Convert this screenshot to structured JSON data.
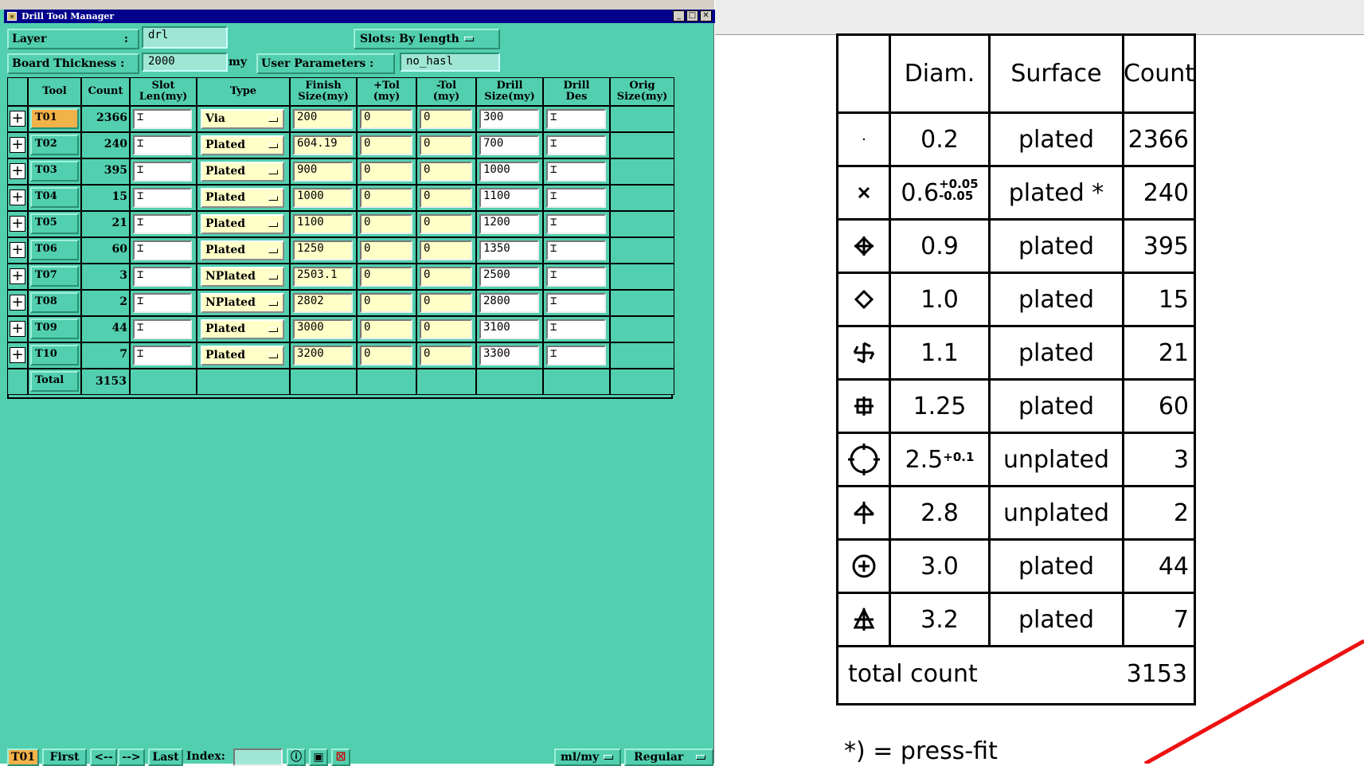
{
  "window": {
    "title": "Drill Tool Manager"
  },
  "form": {
    "layer_label": "Layer",
    "layer_colon": ":",
    "layer_value": "drl",
    "slots_label": "Slots:",
    "slots_value": "By length",
    "thickness_label": "Board Thickness :",
    "thickness_value": "2000",
    "thickness_unit": "my",
    "user_params_label": "User Parameters :",
    "user_params_value": "no_hasl"
  },
  "table": {
    "headers": [
      "Tool",
      "Count",
      "Slot\nLen(my)",
      "Type",
      "Finish\nSize(my)",
      "+Tol\n(my)",
      "-Tol\n(my)",
      "Drill\nSize(my)",
      "Drill\nDes",
      "Orig\nSize(my)"
    ],
    "rows": [
      {
        "tool": "T01",
        "count": "2366",
        "type": "Via",
        "finish": "200",
        "ptol": "0",
        "ntol": "0",
        "drill": "300"
      },
      {
        "tool": "T02",
        "count": "240",
        "type": "Plated",
        "finish": "604.19",
        "ptol": "0",
        "ntol": "0",
        "drill": "700"
      },
      {
        "tool": "T03",
        "count": "395",
        "type": "Plated",
        "finish": "900",
        "ptol": "0",
        "ntol": "0",
        "drill": "1000"
      },
      {
        "tool": "T04",
        "count": "15",
        "type": "Plated",
        "finish": "1000",
        "ptol": "0",
        "ntol": "0",
        "drill": "1100"
      },
      {
        "tool": "T05",
        "count": "21",
        "type": "Plated",
        "finish": "1100",
        "ptol": "0",
        "ntol": "0",
        "drill": "1200"
      },
      {
        "tool": "T06",
        "count": "60",
        "type": "Plated",
        "finish": "1250",
        "ptol": "0",
        "ntol": "0",
        "drill": "1350"
      },
      {
        "tool": "T07",
        "count": "3",
        "type": "NPlated",
        "finish": "2503.1",
        "ptol": "0",
        "ntol": "0",
        "drill": "2500"
      },
      {
        "tool": "T08",
        "count": "2",
        "type": "NPlated",
        "finish": "2802",
        "ptol": "0",
        "ntol": "0",
        "drill": "2800"
      },
      {
        "tool": "T09",
        "count": "44",
        "type": "Plated",
        "finish": "3000",
        "ptol": "0",
        "ntol": "0",
        "drill": "3100"
      },
      {
        "tool": "T10",
        "count": "7",
        "type": "Plated",
        "finish": "3200",
        "ptol": "0",
        "ntol": "0",
        "drill": "3300"
      }
    ],
    "total_label": "Total",
    "total_value": "3153"
  },
  "bottom": {
    "current": "T01",
    "first": "First",
    "prev": "<--",
    "next": "-->",
    "last": "Last",
    "index_label": "Index:",
    "units": "ml/my",
    "mode": "Regular"
  },
  "drawing": {
    "headers": [
      "Diam.",
      "Surface",
      "Count"
    ],
    "rows": [
      {
        "symbol": "dot-symbol",
        "diam": "0.2",
        "sup": "",
        "sub": "",
        "surface": "plated",
        "count": "2366"
      },
      {
        "symbol": "cross-symbol",
        "diam": "0.6",
        "sup": "+0.05",
        "sub": "-0.05",
        "surface": "plated *",
        "count": "240"
      },
      {
        "symbol": "diamond-cross-symbol",
        "diam": "0.9",
        "sup": "",
        "sub": "",
        "surface": "plated",
        "count": "395"
      },
      {
        "symbol": "diamond-symbol",
        "diam": "1.0",
        "sup": "",
        "sub": "",
        "surface": "plated",
        "count": "15"
      },
      {
        "symbol": "swirl-symbol",
        "diam": "1.1",
        "sup": "",
        "sub": "",
        "surface": "plated",
        "count": "21"
      },
      {
        "symbol": "square-grid-symbol",
        "diam": "1.25",
        "sup": "",
        "sub": "",
        "surface": "plated",
        "count": "60"
      },
      {
        "symbol": "circle-target-symbol",
        "diam": "2.5",
        "sup": "+0.1",
        "sub": "",
        "surface": "unplated",
        "count": "3"
      },
      {
        "symbol": "arrow-cross-symbol",
        "diam": "2.8",
        "sup": "",
        "sub": "",
        "surface": "unplated",
        "count": "2"
      },
      {
        "symbol": "circle-plus-symbol",
        "diam": "3.0",
        "sup": "",
        "sub": "",
        "surface": "plated",
        "count": "44"
      },
      {
        "symbol": "triangle-cross-symbol",
        "diam": "3.2",
        "sup": "",
        "sub": "",
        "surface": "plated",
        "count": "7"
      }
    ],
    "total_label": "total count",
    "total_value": "3153",
    "footnote": "*) = press-fit"
  },
  "colors": {
    "window_bg": "#52cfae",
    "field_yellow": "#ffffc8",
    "selected_tool": "#f2b24a",
    "titlebar": "#00008b",
    "red_line": "#ee1111"
  }
}
